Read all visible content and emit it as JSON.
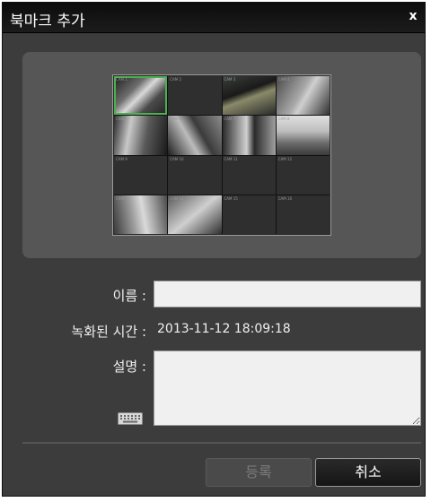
{
  "dialog": {
    "title": "북마크 추가",
    "close_symbol": "x"
  },
  "preview": {
    "cameras": [
      {
        "label": "CAM 1",
        "image": "camera-feed",
        "selected": true
      },
      {
        "label": "CAM 2",
        "image": "empty"
      },
      {
        "label": "CAM 3",
        "image": "camera-feed"
      },
      {
        "label": "CAM 4",
        "image": "camera-feed"
      },
      {
        "label": "CAM 5",
        "image": "camera-feed"
      },
      {
        "label": "CAM 6",
        "image": "camera-feed"
      },
      {
        "label": "CAM 7",
        "image": "camera-feed"
      },
      {
        "label": "CAM 8",
        "image": "camera-feed"
      },
      {
        "label": "CAM 9",
        "image": "empty"
      },
      {
        "label": "CAM 10",
        "image": "empty"
      },
      {
        "label": "CAM 11",
        "image": "empty"
      },
      {
        "label": "CAM 12",
        "image": "empty"
      },
      {
        "label": "CAM 13",
        "image": "camera-feed"
      },
      {
        "label": "CAM 14",
        "image": "camera-feed"
      },
      {
        "label": "CAM 15",
        "image": "empty"
      },
      {
        "label": "CAM 16",
        "image": "empty"
      }
    ]
  },
  "form": {
    "name_label": "이름 :",
    "name_value": "",
    "recorded_label": "녹화된 시간 :",
    "recorded_value": "2013-11-12  18:09:18",
    "description_label": "설명 :",
    "description_value": "",
    "keyboard_icon": "keyboard-icon"
  },
  "buttons": {
    "register_label": "등록",
    "register_enabled": false,
    "cancel_label": "취소"
  }
}
